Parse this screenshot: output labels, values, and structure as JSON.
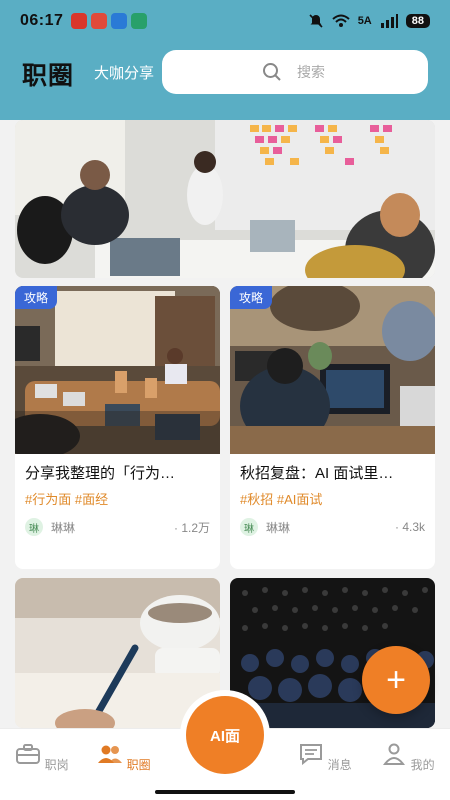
{
  "status": {
    "time": "06:17",
    "network": "5A",
    "battery": "88"
  },
  "header": {
    "title": "职圈",
    "subtitle": "大咖分享",
    "search_placeholder": "搜索"
  },
  "feed": {
    "hero": {
      "image": "team meeting with sticky notes on board"
    },
    "cards": [
      {
        "badge": "攻略",
        "title": "分享我整理的「行为…",
        "tags": "#行为面 #面经",
        "author_avatar": "琳",
        "author": "琳琳",
        "views": "· 1.2万",
        "image": "conference room with laptops"
      },
      {
        "badge": "攻略",
        "title": "秋招复盘：AI 面试里…",
        "tags": "#秋招 #AI面试",
        "author_avatar": "琳",
        "author": "琳琳",
        "views": "· 4.3k",
        "image": "people working on laptops"
      },
      {
        "image": "writing notes with coffee cup"
      },
      {
        "image": "audience at a tech talk"
      }
    ]
  },
  "fab": {
    "icon": "+"
  },
  "nav": {
    "items": [
      {
        "label": "职岗",
        "icon": "briefcase-icon"
      },
      {
        "label": "职圈",
        "icon": "people-icon"
      },
      {
        "label": "AI面",
        "icon": "ai-interview"
      },
      {
        "label": "消息",
        "icon": "message-icon"
      },
      {
        "label": "我的",
        "icon": "user-icon"
      }
    ]
  },
  "colors": {
    "header_bg": "#5aaec4",
    "accent": "#ef7f26",
    "badge": "#3a67d6",
    "tag_text": "#e08a2a"
  }
}
